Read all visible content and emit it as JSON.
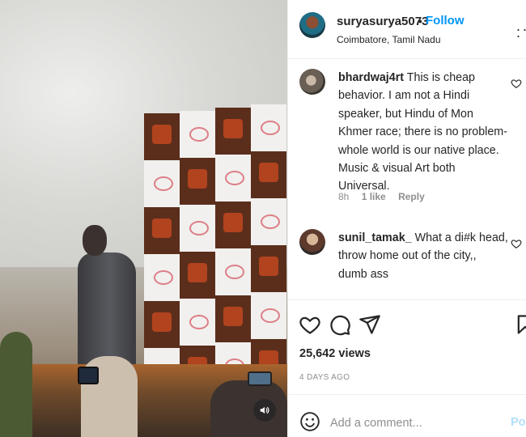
{
  "post": {
    "username": "suryasurya5073",
    "separator": "•",
    "follow_label": "Follow",
    "location": "Coimbatore, Tamil Nadu",
    "more_label": ". . ."
  },
  "comments": [
    {
      "username": "bhardwaj4rt",
      "text": "This is cheap behavior. I am not a Hindi speaker, but Hindu of Mon Khmer race; there is no problem- whole world is our native place. Music & visual Art both Universal.",
      "time": "8h",
      "likes": "1 like",
      "reply_label": "Reply"
    },
    {
      "username": "sunil_tamak_",
      "text": "What a di#k head, throw home out of the city,, dumb ass"
    }
  ],
  "stats": {
    "views": "25,642 views",
    "date": "4 DAYS AGO"
  },
  "add_comment": {
    "placeholder": "Add a comment...",
    "post_label": "Post"
  },
  "icons": {
    "like": "heart-icon",
    "comment": "comment-bubble-icon",
    "share": "paper-plane-icon",
    "save": "bookmark-icon",
    "emoji": "smiley-icon",
    "mute": "speaker-icon",
    "more": "ellipsis-icon"
  },
  "colors": {
    "accent": "#0095f6",
    "post_disabled": "#b2dffc",
    "text": "#262626",
    "muted": "#8e8e8e"
  }
}
